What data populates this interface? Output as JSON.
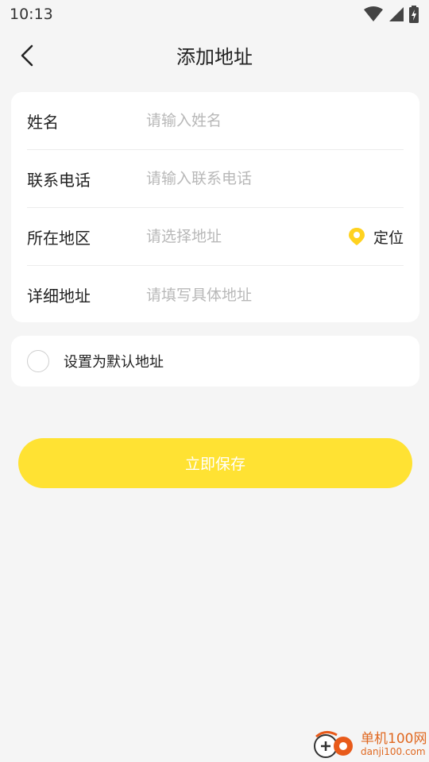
{
  "status": {
    "time": "10:13"
  },
  "header": {
    "title": "添加地址"
  },
  "form": {
    "name": {
      "label": "姓名",
      "placeholder": "请输入姓名"
    },
    "phone": {
      "label": "联系电话",
      "placeholder": "请输入联系电话"
    },
    "region": {
      "label": "所在地区",
      "placeholder": "请选择地址",
      "locate_label": "定位"
    },
    "detail": {
      "label": "详细地址",
      "placeholder": "请填写具体地址"
    }
  },
  "default_address": {
    "label": "设置为默认地址",
    "checked": false
  },
  "save_button": {
    "label": "立即保存"
  },
  "colors": {
    "accent": "#ffe233",
    "pin": "#ffd21f"
  },
  "watermark": {
    "cn": "单机100网",
    "en": "danji100.com"
  }
}
